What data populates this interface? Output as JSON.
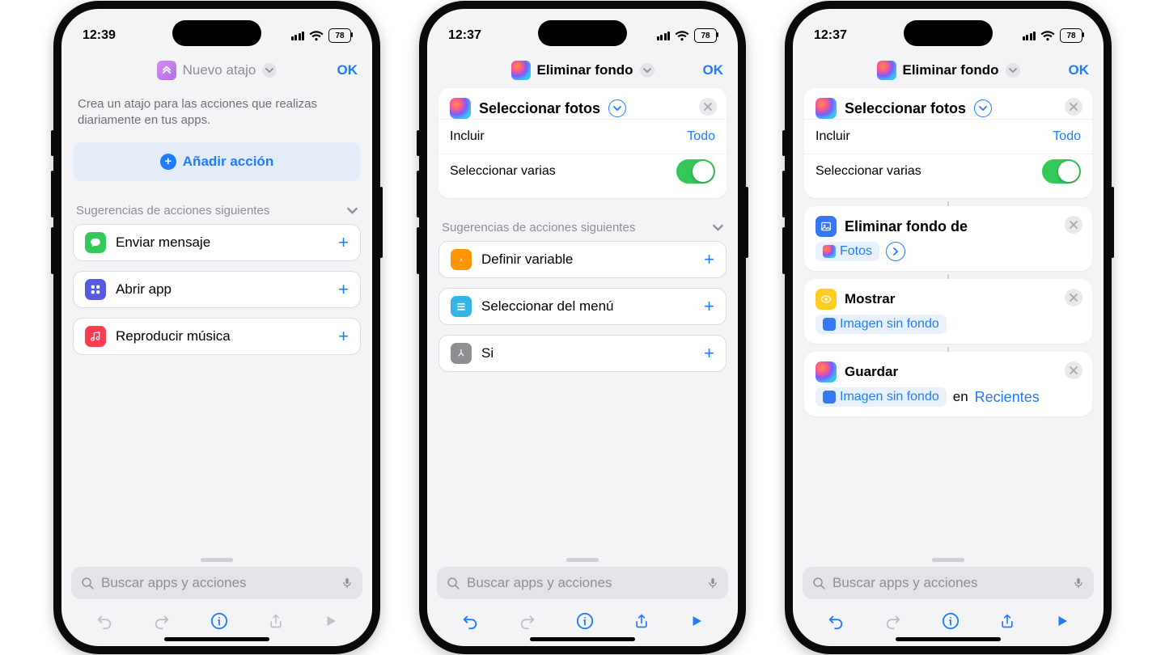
{
  "status": {
    "battery": "78"
  },
  "phone1": {
    "time": "12:39",
    "title": "Nuevo atajo",
    "ok": "OK",
    "intro": "Crea un atajo para las acciones que realizas diariamente en tus apps.",
    "add_action": "Añadir acción",
    "sug_header": "Sugerencias de acciones siguientes",
    "sug": [
      "Enviar mensaje",
      "Abrir app",
      "Reproducir música"
    ],
    "search_ph": "Buscar apps y acciones"
  },
  "phone2": {
    "time": "12:37",
    "title": "Eliminar fondo",
    "ok": "OK",
    "action_title": "Seleccionar fotos",
    "include_lbl": "Incluir",
    "include_val": "Todo",
    "multi_lbl": "Seleccionar varias",
    "sug_header": "Sugerencias de acciones siguientes",
    "sug": [
      "Definir variable",
      "Seleccionar del menú",
      "Si"
    ],
    "search_ph": "Buscar apps y acciones"
  },
  "phone3": {
    "time": "12:37",
    "title": "Eliminar fondo",
    "ok": "OK",
    "a1_title": "Seleccionar fotos",
    "include_lbl": "Incluir",
    "include_val": "Todo",
    "multi_lbl": "Seleccionar varias",
    "a2_title": "Eliminar fondo de",
    "a2_token": "Fotos",
    "a3_title": "Mostrar",
    "a3_token": "Imagen sin fondo",
    "a4_title": "Guardar",
    "a4_token": "Imagen sin fondo",
    "a4_conj": "en",
    "a4_dest": "Recientes",
    "search_ph": "Buscar apps y acciones"
  }
}
